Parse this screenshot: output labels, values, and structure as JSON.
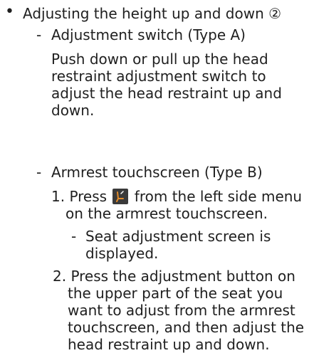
{
  "colors": {
    "text": "#1f1f1f",
    "icon_bg": "#3a3a3a",
    "icon_fg": "#e08a2a"
  },
  "section": {
    "bullet": "•",
    "title": "Adjusting the height up and down ②",
    "type_a": {
      "dash": "-",
      "heading": "Adjustment switch (Type A)",
      "body_lines": [
        "Push down or pull up the head",
        "restraint adjustment switch to",
        "adjust the head restraint up and",
        "down."
      ]
    },
    "type_b": {
      "dash": "-",
      "heading": "Armrest touchscreen (Type B)",
      "step1": {
        "prefix": "1. Press",
        "icon": "seat-adjust-icon",
        "suffix": "from the left side menu",
        "line2": "on the armrest touchscreen."
      },
      "note": {
        "dash": "-",
        "line1": "Seat adjustment screen is",
        "line2": "displayed."
      },
      "step2_lines": [
        "2. Press the adjustment button on",
        "the upper part of the seat you",
        "want to adjust from the armrest",
        "touchscreen, and then adjust the",
        "head restraint up and down."
      ]
    }
  }
}
